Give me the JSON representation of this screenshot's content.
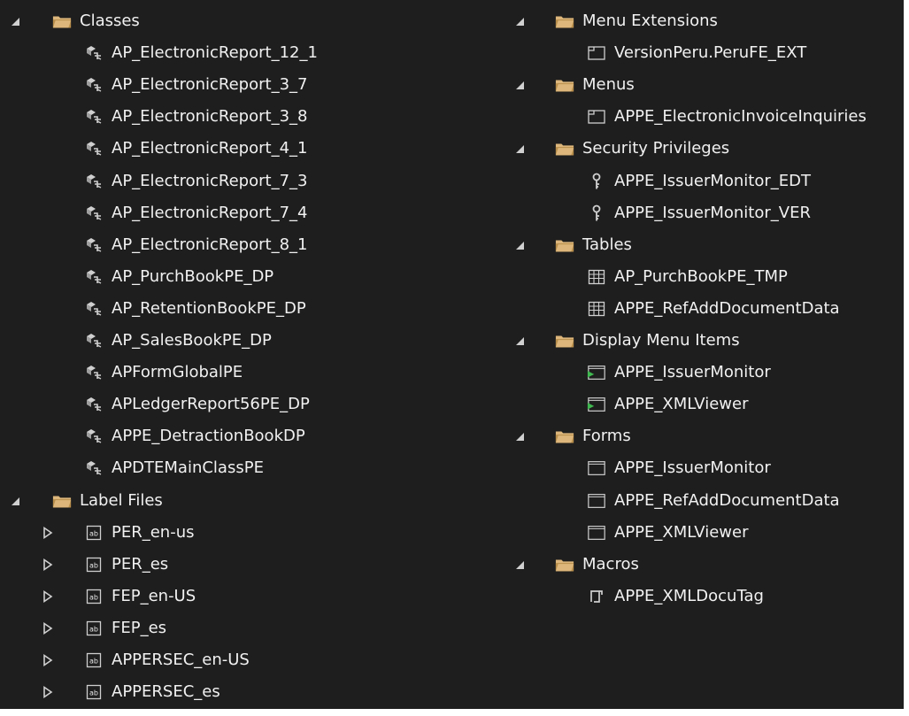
{
  "left": {
    "classes": {
      "label": "Classes",
      "items": [
        "AP_ElectronicReport_12_1",
        "AP_ElectronicReport_3_7",
        "AP_ElectronicReport_3_8",
        "AP_ElectronicReport_4_1",
        "AP_ElectronicReport_7_3",
        "AP_ElectronicReport_7_4",
        "AP_ElectronicReport_8_1",
        "AP_PurchBookPE_DP",
        "AP_RetentionBookPE_DP",
        "AP_SalesBookPE_DP",
        "APFormGlobalPE",
        "APLedgerReport56PE_DP",
        "APPE_DetractionBookDP",
        "APDTEMainClassPE"
      ]
    },
    "label_files": {
      "label": "Label Files",
      "items": [
        "PER_en-us",
        "PER_es",
        "FEP_en-US",
        "FEP_es",
        "APPERSEC_en-US",
        "APPERSEC_es"
      ]
    }
  },
  "right": {
    "menu_extensions": {
      "label": "Menu Extensions",
      "items": [
        "VersionPeru.PeruFE_EXT"
      ]
    },
    "menus": {
      "label": "Menus",
      "items": [
        "APPE_ElectronicInvoiceInquiries"
      ]
    },
    "security_privileges": {
      "label": "Security Privileges",
      "items": [
        "APPE_IssuerMonitor_EDT",
        "APPE_IssuerMonitor_VER"
      ]
    },
    "tables": {
      "label": "Tables",
      "items": [
        "AP_PurchBookPE_TMP",
        "APPE_RefAddDocumentData"
      ]
    },
    "display_menu_items": {
      "label": "Display Menu Items",
      "items": [
        "APPE_IssuerMonitor",
        "APPE_XMLViewer"
      ]
    },
    "forms": {
      "label": "Forms",
      "items": [
        "APPE_IssuerMonitor",
        "APPE_RefAddDocumentData",
        "APPE_XMLViewer"
      ]
    },
    "macros": {
      "label": "Macros",
      "items": [
        "APPE_XMLDocuTag"
      ]
    }
  },
  "icons": {
    "expanded": "expanded-triangle-icon",
    "collapsed": "collapsed-triangle-icon",
    "folder": "folder-icon",
    "class": "class-icon",
    "label_file": "label-file-icon",
    "menu": "menu-icon",
    "key": "key-icon",
    "table": "table-icon",
    "display_menu_item": "display-menu-item-icon",
    "form": "form-icon",
    "macro": "macro-icon"
  },
  "colors": {
    "background": "#1e1e1e",
    "text": "#f1f1f1",
    "folder": "#dcb67a",
    "arrow": "#d0d0d0",
    "action_green": "#3fb950"
  }
}
